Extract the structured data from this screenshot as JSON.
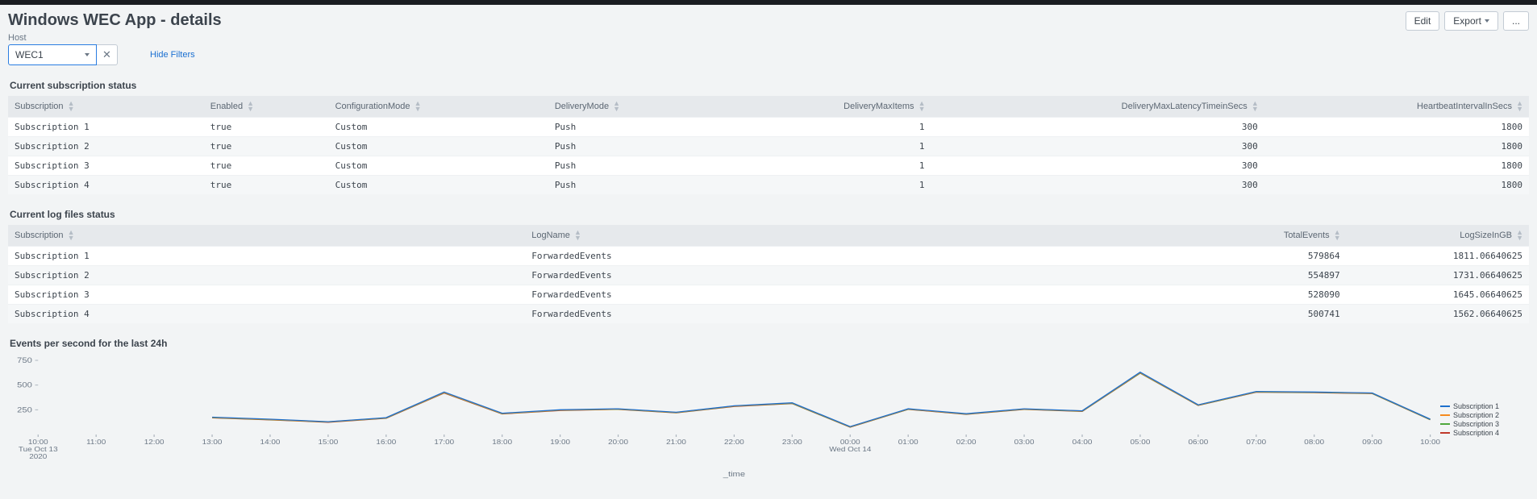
{
  "header": {
    "title": "Windows WEC App - details",
    "edit_label": "Edit",
    "export_label": "Export",
    "more_label": "..."
  },
  "filters": {
    "host_label": "Host",
    "host_value": "WEC1",
    "hide_filters_label": "Hide Filters"
  },
  "panels": {
    "subs": {
      "title": "Current subscription status",
      "columns": [
        "Subscription",
        "Enabled",
        "ConfigurationMode",
        "DeliveryMode",
        "DeliveryMaxItems",
        "DeliveryMaxLatencyTimeinSecs",
        "HeartbeatIntervalInSecs"
      ],
      "rows": [
        [
          "Subscription 1",
          "true",
          "Custom",
          "Push",
          "1",
          "300",
          "1800"
        ],
        [
          "Subscription 2",
          "true",
          "Custom",
          "Push",
          "1",
          "300",
          "1800"
        ],
        [
          "Subscription 3",
          "true",
          "Custom",
          "Push",
          "1",
          "300",
          "1800"
        ],
        [
          "Subscription 4",
          "true",
          "Custom",
          "Push",
          "1",
          "300",
          "1800"
        ]
      ]
    },
    "logs": {
      "title": "Current log files status",
      "columns": [
        "Subscription",
        "LogName",
        "TotalEvents",
        "LogSizeInGB"
      ],
      "rows": [
        [
          "Subscription 1",
          "ForwardedEvents",
          "579864",
          "1811.06640625"
        ],
        [
          "Subscription 2",
          "ForwardedEvents",
          "554897",
          "1731.06640625"
        ],
        [
          "Subscription 3",
          "ForwardedEvents",
          "528090",
          "1645.06640625"
        ],
        [
          "Subscription 4",
          "ForwardedEvents",
          "500741",
          "1562.06640625"
        ]
      ]
    },
    "events": {
      "title": "Events per second for the last 24h"
    }
  },
  "chart_data": {
    "type": "line",
    "xlabel": "_time",
    "ylabel": "",
    "ylim": [
      0,
      750
    ],
    "yticks": [
      250,
      500,
      750
    ],
    "x_display": [
      {
        "label": "10:00",
        "sub": "Tue Oct 13",
        "sub2": "2020"
      },
      {
        "label": "11:00"
      },
      {
        "label": "12:00"
      },
      {
        "label": "13:00"
      },
      {
        "label": "14:00"
      },
      {
        "label": "15:00"
      },
      {
        "label": "16:00"
      },
      {
        "label": "17:00"
      },
      {
        "label": "18:00"
      },
      {
        "label": "19:00"
      },
      {
        "label": "20:00"
      },
      {
        "label": "21:00"
      },
      {
        "label": "22:00"
      },
      {
        "label": "23:00"
      },
      {
        "label": "00:00",
        "sub": "Wed Oct 14"
      },
      {
        "label": "01:00"
      },
      {
        "label": "02:00"
      },
      {
        "label": "03:00"
      },
      {
        "label": "04:00"
      },
      {
        "label": "05:00"
      },
      {
        "label": "06:00"
      },
      {
        "label": "07:00"
      },
      {
        "label": "08:00"
      },
      {
        "label": "09:00"
      },
      {
        "label": "10:00"
      }
    ],
    "series": [
      {
        "name": "Subscription 1",
        "color": "#1e70cd",
        "values": [
          null,
          null,
          null,
          175,
          155,
          130,
          170,
          430,
          215,
          250,
          260,
          225,
          290,
          320,
          80,
          260,
          210,
          260,
          240,
          630,
          300,
          435,
          430,
          420,
          155
        ]
      },
      {
        "name": "Subscription 2",
        "color": "#f58b1f",
        "values": [
          null,
          null,
          null,
          172,
          152,
          128,
          168,
          425,
          212,
          247,
          258,
          223,
          288,
          318,
          78,
          258,
          208,
          258,
          238,
          625,
          298,
          432,
          427,
          418,
          153
        ]
      },
      {
        "name": "Subscription 3",
        "color": "#4fa83d",
        "values": [
          null,
          null,
          null,
          170,
          150,
          126,
          166,
          422,
          210,
          245,
          256,
          221,
          286,
          315,
          76,
          256,
          206,
          256,
          236,
          622,
          296,
          430,
          425,
          416,
          151
        ]
      },
      {
        "name": "Subscription 4",
        "color": "#c0392b",
        "values": [
          null,
          null,
          null,
          168,
          148,
          124,
          164,
          420,
          208,
          243,
          254,
          219,
          284,
          313,
          74,
          254,
          204,
          254,
          234,
          620,
          294,
          428,
          423,
          414,
          149
        ]
      }
    ]
  }
}
